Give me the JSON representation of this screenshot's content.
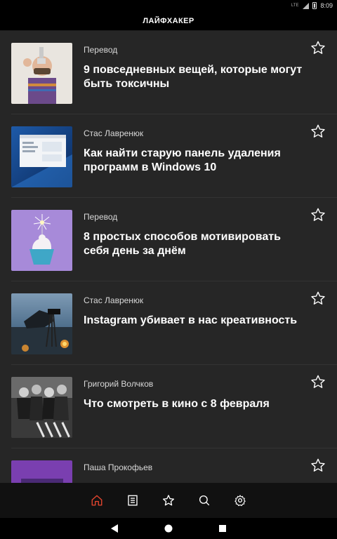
{
  "status_bar": {
    "network": "LTE",
    "time": "8:09"
  },
  "header": {
    "title": "ЛАЙФХАКЕР"
  },
  "articles": [
    {
      "author": "Перевод",
      "title": "9 повседневных вещей, которые могут быть токсичны"
    },
    {
      "author": "Стас Лавренюк",
      "title": "Как найти старую панель удаления программ в Windows 10"
    },
    {
      "author": "Перевод",
      "title": "8 простых способов мотивировать себя день за днём"
    },
    {
      "author": "Стас Лавренюк",
      "title": "Instagram убивает в нас креативность"
    },
    {
      "author": "Григорий Волчков",
      "title": "Что смотреть в кино с 8 февраля"
    },
    {
      "author": "Паша Прокофьев",
      "title": ""
    }
  ],
  "bottom_nav": [
    {
      "icon": "home-icon",
      "active": true
    },
    {
      "icon": "list-icon",
      "active": false
    },
    {
      "icon": "star-icon",
      "active": false
    },
    {
      "icon": "search-icon",
      "active": false
    },
    {
      "icon": "gear-icon",
      "active": false
    }
  ],
  "colors": {
    "accent": "#e8462f",
    "background": "#262626",
    "bar": "#111111"
  }
}
